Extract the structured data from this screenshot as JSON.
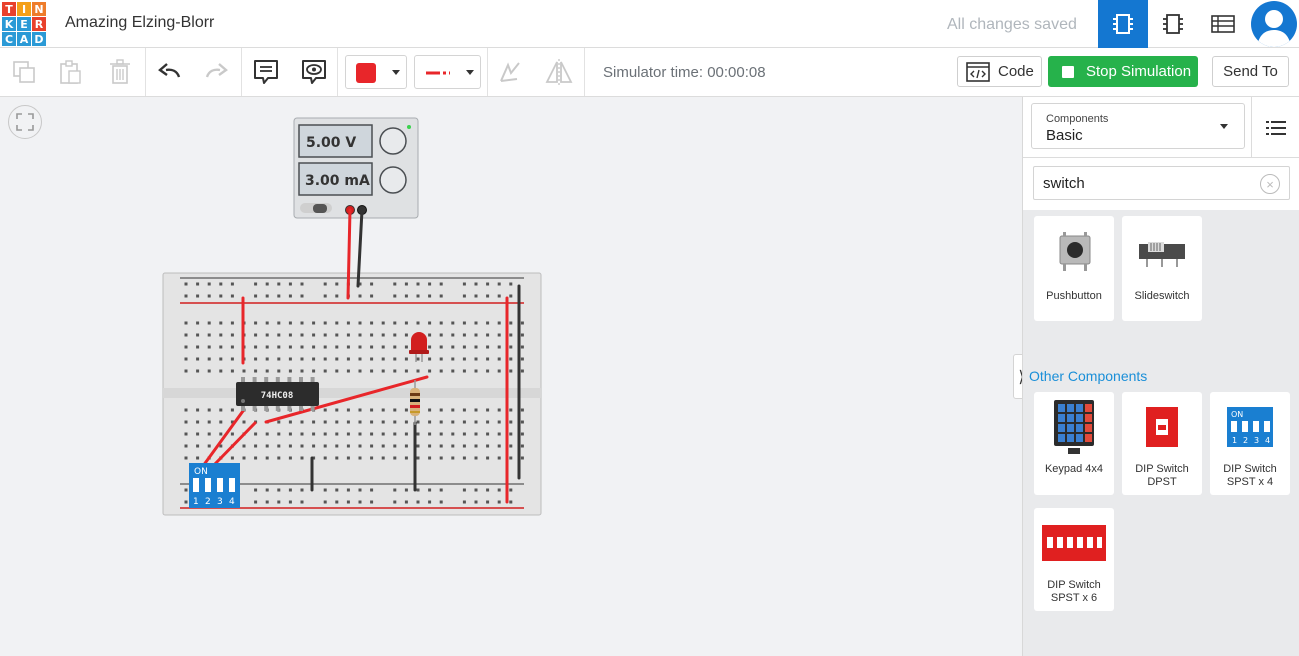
{
  "logo": {
    "letters": [
      "T",
      "I",
      "N",
      "K",
      "E",
      "R",
      "C",
      "A",
      "D"
    ],
    "colors": [
      "#e8412c",
      "#f4a018",
      "#ee7c2a",
      "#2b9ad6",
      "#2b9ad6",
      "#e8412c",
      "#2b9ad6",
      "#2b9ad6",
      "#2b9ad6"
    ]
  },
  "header": {
    "project_title": "Amazing Elzing-Blorr",
    "save_status": "All changes saved",
    "views": [
      "circuit-view-icon",
      "schematic-view-icon",
      "component-list-icon"
    ]
  },
  "toolbar": {
    "simulator_time": "Simulator time: 00:00:08",
    "code_label": "Code",
    "stop_label": "Stop Simulation",
    "send_label": "Send To",
    "wire_color": "#e8262a"
  },
  "circuit": {
    "power_supply": {
      "voltage": "5.00 V",
      "current": "3.00 mA"
    },
    "chip_label": "74HC08",
    "dip_label": "ON",
    "dip_numbers": [
      "1",
      "2",
      "3",
      "4"
    ]
  },
  "panel": {
    "components_label": "Components",
    "components_value": "Basic",
    "search_value": "switch",
    "basic_results": [
      {
        "name": "Pushbutton"
      },
      {
        "name": "Slideswitch"
      }
    ],
    "other_title": "Other Components",
    "other_results": [
      {
        "name": "Keypad 4x4"
      },
      {
        "name": "DIP Switch DPST"
      },
      {
        "name": "DIP Switch SPST x 4"
      },
      {
        "name": "DIP Switch SPST x 6"
      }
    ]
  }
}
